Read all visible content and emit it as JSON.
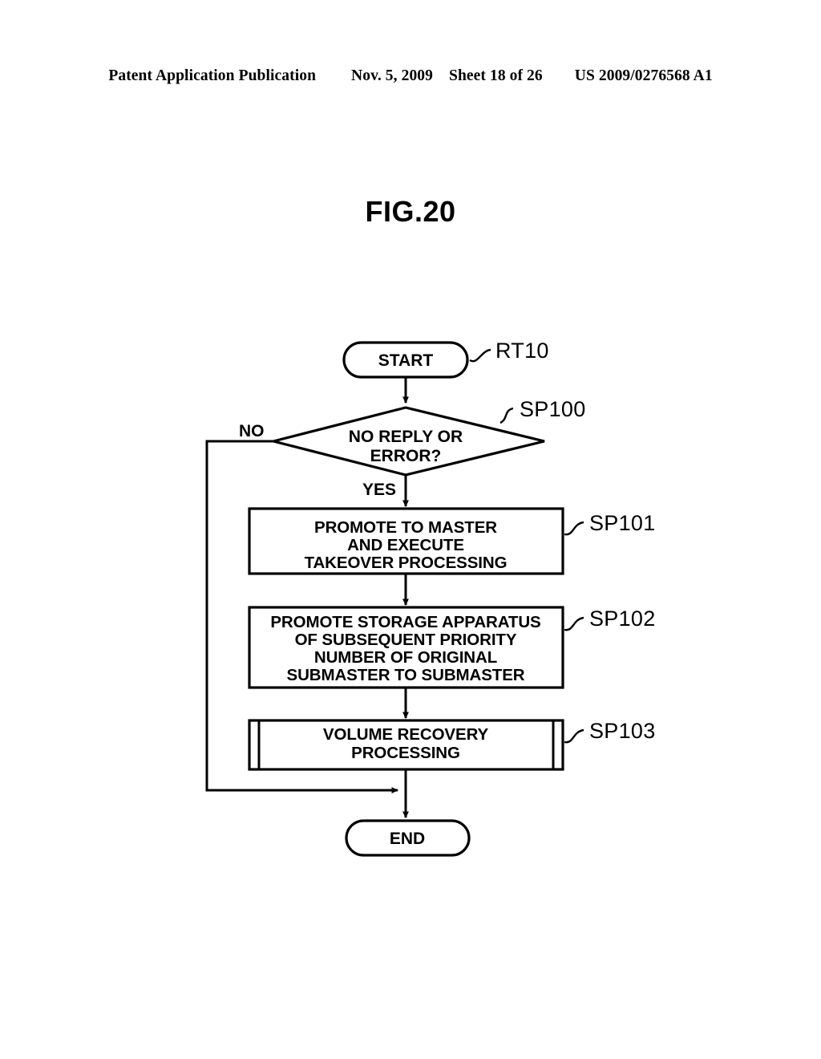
{
  "header": {
    "publication": "Patent Application Publication",
    "date": "Nov. 5, 2009",
    "sheet": "Sheet 18 of 26",
    "patent_number": "US 2009/0276568 A1"
  },
  "figure": {
    "title": "FIG.20",
    "routine_label": "RT10"
  },
  "flowchart": {
    "start_node": "START",
    "end_node": "END",
    "decision": {
      "line1": "NO REPLY OR",
      "line2": "ERROR?",
      "step_label": "SP100",
      "yes_label": "YES",
      "no_label": "NO"
    },
    "steps": [
      {
        "step_label": "SP101",
        "shape": "process",
        "lines": [
          "PROMOTE TO MASTER",
          "AND EXECUTE",
          "TAKEOVER PROCESSING"
        ]
      },
      {
        "step_label": "SP102",
        "shape": "process",
        "lines": [
          "PROMOTE STORAGE APPARATUS",
          "OF SUBSEQUENT PRIORITY",
          "NUMBER OF ORIGINAL",
          "SUBMASTER TO SUBMASTER"
        ]
      },
      {
        "step_label": "SP103",
        "shape": "predefined-process",
        "lines": [
          "VOLUME RECOVERY",
          "PROCESSING"
        ]
      }
    ]
  },
  "colors": {
    "ink": "#000000",
    "paper": "#ffffff"
  }
}
